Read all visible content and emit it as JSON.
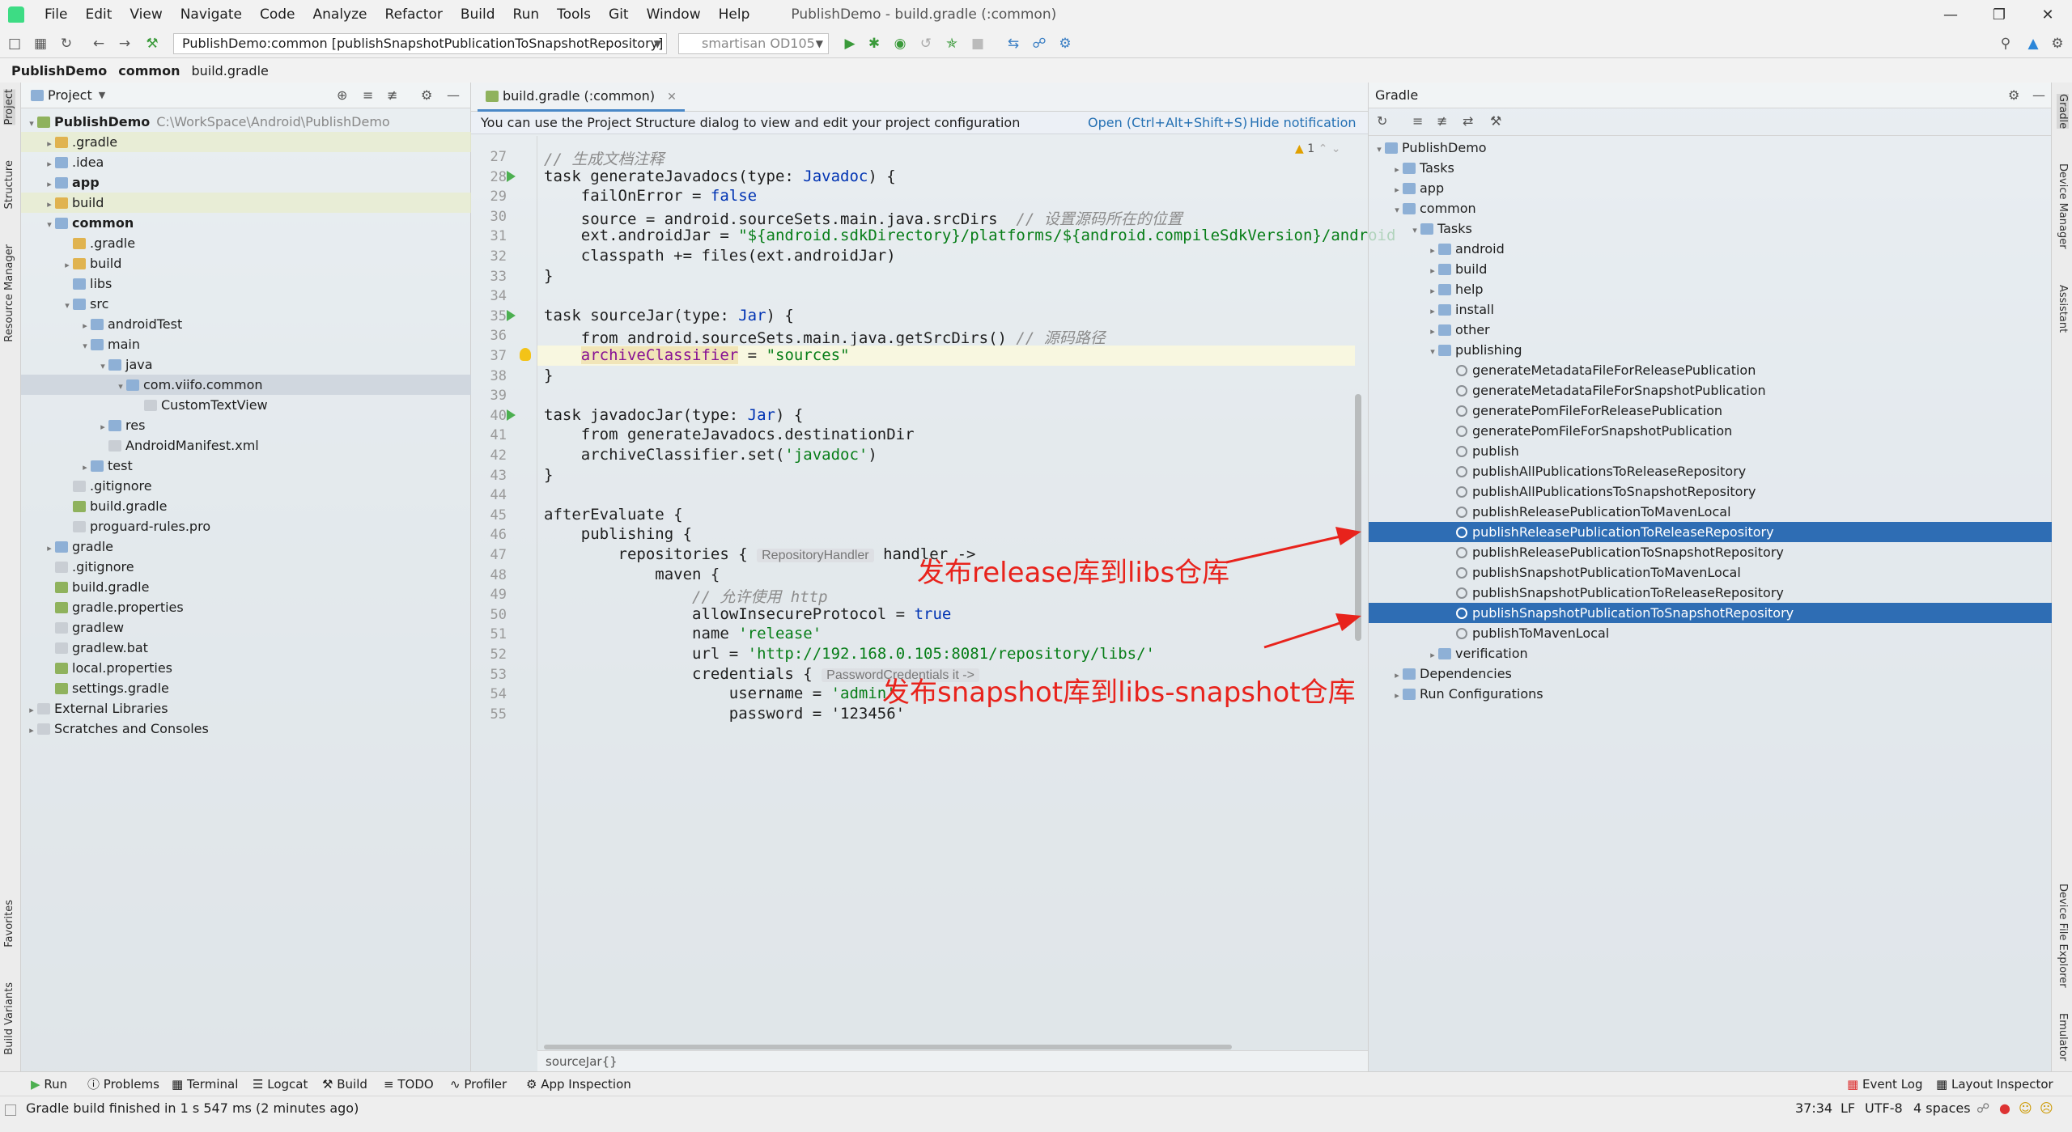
{
  "window": {
    "title": "PublishDemo - build.gradle (:common)"
  },
  "menu": [
    "File",
    "Edit",
    "View",
    "Navigate",
    "Code",
    "Analyze",
    "Refactor",
    "Build",
    "Run",
    "Tools",
    "Git",
    "Window",
    "Help"
  ],
  "toolbar": {
    "run_config": "PublishDemo:common [publishSnapshotPublicationToSnapshotRepository]",
    "device": "smartisan OD105"
  },
  "breadcrumb": [
    "PublishDemo",
    "common",
    "build.gradle"
  ],
  "left_strip": [
    "Project",
    "Structure",
    "Resource Manager",
    "Favorites",
    "Build Variants"
  ],
  "right_strip": [
    "Gradle",
    "Device Manager",
    "Assistant",
    "Device File Explorer",
    "Emulator"
  ],
  "project": {
    "title": "Project",
    "root": "PublishDemo",
    "root_path": "C:\\WorkSpace\\Android\\PublishDemo",
    "items": [
      ".gradle",
      ".idea",
      "app",
      "build",
      "common",
      ".gradle",
      "build",
      "libs",
      "src",
      "androidTest",
      "main",
      "java",
      "com.viifo.common",
      "CustomTextView",
      "res",
      "AndroidManifest.xml",
      "test",
      ".gitignore",
      "build.gradle",
      "proguard-rules.pro",
      "gradle",
      ".gitignore",
      "build.gradle",
      "gradle.properties",
      "gradlew",
      "gradlew.bat",
      "local.properties",
      "settings.gradle",
      "External Libraries",
      "Scratches and Consoles"
    ]
  },
  "editor": {
    "tab": "build.gradle (:common)",
    "notice": "You can use the Project Structure dialog to view and edit your project configuration",
    "notice_open": "Open (Ctrl+Alt+Shift+S)",
    "notice_hide": "Hide notification",
    "warnings": "1",
    "line_numbers": [
      "27",
      "28",
      "29",
      "30",
      "31",
      "32",
      "33",
      "34",
      "35",
      "36",
      "37",
      "38",
      "39",
      "40",
      "41",
      "42",
      "43",
      "44",
      "45",
      "46",
      "47",
      "48",
      "49",
      "50",
      "51",
      "52",
      "53",
      "54",
      "55"
    ],
    "c27": "// 生成文档注释",
    "c28a": "task generateJavadocs(type: ",
    "c28b": "Javadoc",
    ") {": ") {",
    "c29a": "    failOnError = ",
    "c29b": "false",
    "c30a": "    source = android.sourceSets.main.java.srcDirs  ",
    "c30b": "// 设置源码所在的位置",
    "c31a": "    ext.androidJar = ",
    "c31b": "\"${android.sdkDirectory}/platforms/${android.compileSdkVersion}/android",
    "c32": "    classpath += files(ext.androidJar)",
    "c33": "}",
    "c35a": "task sourceJar(type: ",
    "c35b": "Jar",
    "c36a": "    from android.sourceSets.main.java.getSrcDirs() ",
    "c36b": "// 源码路径",
    "c37a": "archiveClassifier",
    "c37b": " = ",
    "c37c": "\"sources\"",
    "c38": "}",
    "c40a": "task javadocJar(type: ",
    "c40b": "Jar",
    "c41": "    from generateJavadocs.destinationDir",
    "c42a": "    archiveClassifier.set(",
    "c42b": "'javadoc'",
    "c43": "}",
    "c45": "afterEvaluate {",
    "c46": "    publishing {",
    "c47a": "        repositories { ",
    "c47h": "RepositoryHandler",
    "c47b": " handler ->",
    "c48": "            maven {",
    "c49": "                // 允许使用 http",
    "c50a": "                allowInsecureProtocol = ",
    "c50b": "true",
    "c51a": "                name ",
    "c51b": "'release'",
    "c52a": "                url = ",
    "c52b": "'http://192.168.0.105:8081/repository/libs/'",
    "c53a": "                credentials { ",
    "c53h": "PasswordCredentials it ->",
    "c54a": "                    username = ",
    "c54b": "'admin'",
    "c55": "                    password = '123456'",
    "footer": "sourceJar{}"
  },
  "gradle": {
    "title": "Gradle",
    "root": "PublishDemo",
    "items": [
      "Tasks",
      "app",
      "common",
      "Tasks",
      "android",
      "build",
      "help",
      "install",
      "other",
      "publishing",
      "generateMetadataFileForReleasePublication",
      "generateMetadataFileForSnapshotPublication",
      "generatePomFileForReleasePublication",
      "generatePomFileForSnapshotPublication",
      "publish",
      "publishAllPublicationsToReleaseRepository",
      "publishAllPublicationsToSnapshotRepository",
      "publishReleasePublicationToMavenLocal",
      "publishReleasePublicationToReleaseRepository",
      "publishReleasePublicationToSnapshotRepository",
      "publishSnapshotPublicationToMavenLocal",
      "publishSnapshotPublicationToReleaseRepository",
      "publishSnapshotPublicationToSnapshotRepository",
      "publishToMavenLocal",
      "verification",
      "Dependencies",
      "Run Configurations"
    ]
  },
  "annotations": {
    "release": "发布release库到libs仓库",
    "snapshot": "发布snapshot库到libs-snapshot仓库"
  },
  "bottom_tabs": [
    "Run",
    "Problems",
    "Terminal",
    "Logcat",
    "Build",
    "TODO",
    "Profiler",
    "App Inspection",
    "Event Log",
    "Layout Inspector"
  ],
  "status": {
    "message": "Gradle build finished in 1 s 547 ms (2 minutes ago)",
    "position": "37:34",
    "line_sep": "LF",
    "encoding": "UTF-8",
    "indent": "4 spaces"
  },
  "colors": {
    "accent": "#2e6db4",
    "annotation": "#e8231c"
  }
}
